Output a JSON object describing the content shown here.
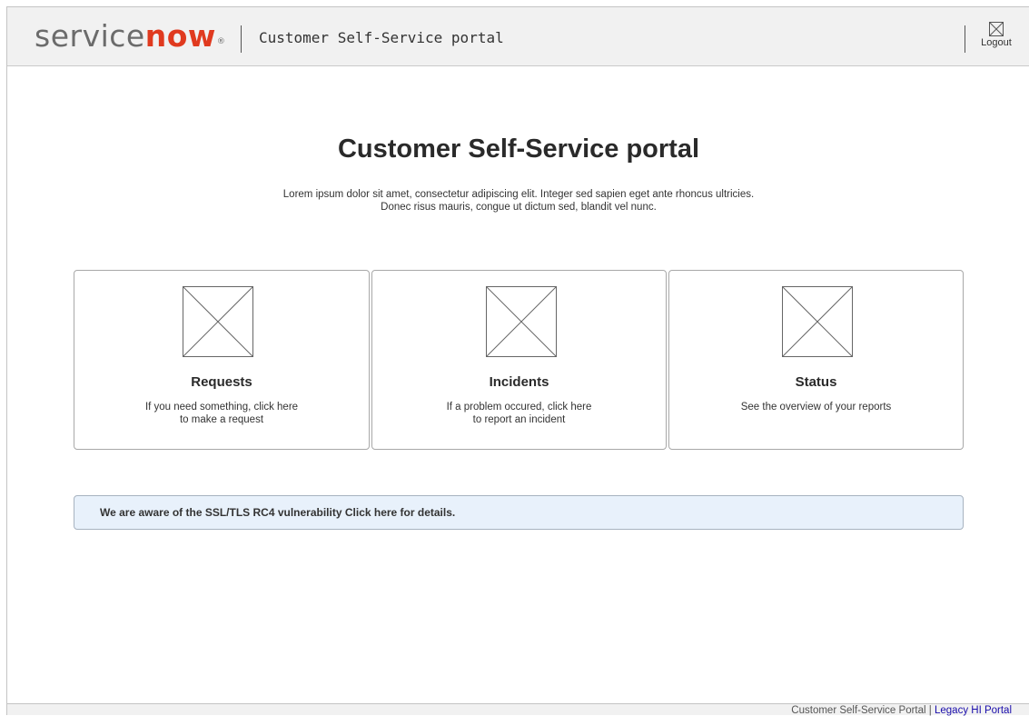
{
  "header": {
    "logo_service": "service",
    "logo_now": "now",
    "logo_reg": "®",
    "title": "Customer Self-Service portal",
    "logout_icon": "logout-icon",
    "logout_label": "Logout"
  },
  "main": {
    "title": "Customer Self-Service portal",
    "intro_line1": "Lorem ipsum dolor sit amet, consectetur adipiscing elit. Integer sed sapien eget ante rhoncus ultricies.",
    "intro_line2": "Donec risus mauris, congue ut dictum sed, blandit vel nunc."
  },
  "cards": [
    {
      "icon": "image-placeholder-icon",
      "title": "Requests",
      "desc_line1": "If you need something, click here",
      "desc_line2": "to make a request"
    },
    {
      "icon": "image-placeholder-icon",
      "title": "Incidents",
      "desc_line1": "If a problem occured, click here",
      "desc_line2": "to report an incident"
    },
    {
      "icon": "image-placeholder-icon",
      "title": "Status",
      "desc_line1": "See the overview of your reports",
      "desc_line2": ""
    }
  ],
  "notice": {
    "text": "We are aware of the SSL/TLS RC4 vulnerability Click here for details."
  },
  "footer": {
    "portal_label": "Customer Self-Service Portal",
    "separator": "|",
    "legacy_link": "Legacy HI Portal"
  },
  "colors": {
    "brand_green": "#e03a1f",
    "notice_bg": "#e8f1fb",
    "link": "#1a0dab"
  }
}
